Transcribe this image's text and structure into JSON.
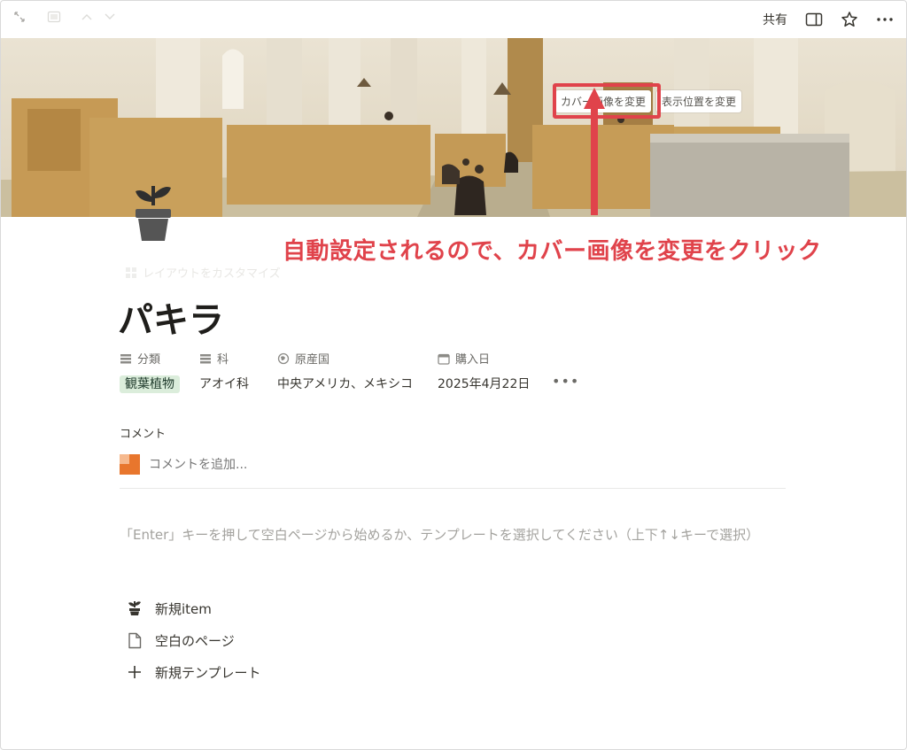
{
  "topbar": {
    "share_label": "共有"
  },
  "cover": {
    "change_cover_label": "カバー画像を変更",
    "reposition_label": "表示位置を変更"
  },
  "annotation": {
    "text": "自動設定されるので、カバー画像を変更をクリック",
    "color": "#e0434b"
  },
  "page": {
    "customize_label": "レイアウトをカスタマイズ",
    "title": "パキラ",
    "icon": "plant-pot-icon"
  },
  "properties": [
    {
      "label": "分類",
      "value": "観葉植物",
      "icon": "list-icon"
    },
    {
      "label": "科",
      "value": "アオイ科",
      "icon": "list-icon"
    },
    {
      "label": "原産国",
      "value": "中央アメリカ、メキシコ",
      "icon": "location-icon"
    },
    {
      "label": "購入日",
      "value": "2025年4月22日",
      "icon": "calendar-icon"
    }
  ],
  "comments": {
    "label": "コメント",
    "placeholder": "コメントを追加..."
  },
  "hint": "「Enter」キーを押して空白ページから始めるか、テンプレートを選択してください（上下↑↓キーで選択）",
  "templates": [
    {
      "label": "新規item",
      "icon": "plant-pot-icon"
    },
    {
      "label": "空白のページ",
      "icon": "page-icon"
    },
    {
      "label": "新規テンプレート",
      "icon": "plus-icon"
    }
  ]
}
